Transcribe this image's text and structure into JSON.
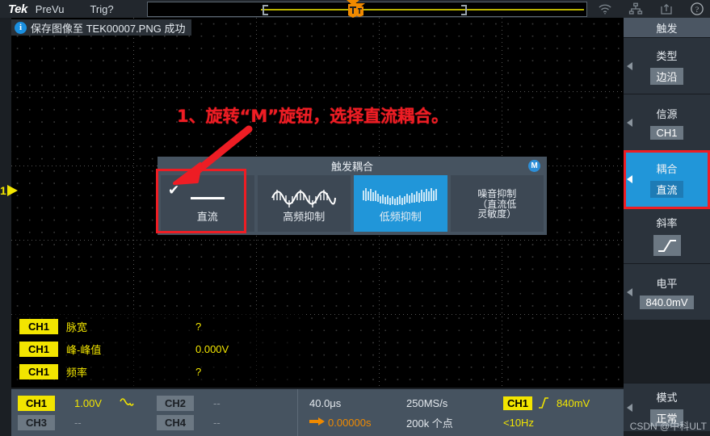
{
  "topbar": {
    "brand": "Tek",
    "prevu": "PreVu",
    "trigger_state": "Trig?",
    "icons": [
      "wifi-icon",
      "network-icon",
      "usb-eject-icon",
      "help-icon"
    ]
  },
  "message": {
    "icon": "info-icon",
    "icon_glyph": "i",
    "text": "保存图像至 TEK00007.PNG 成功"
  },
  "graticule": {
    "channel_marker_number": "1",
    "trigger_marker_letter": "T"
  },
  "annotation": {
    "text": "1、旋转“M”旋钮，选择直流耦合。",
    "color": "#ee1d24"
  },
  "dialog": {
    "title": "触发耦合",
    "badge": "M",
    "options": [
      {
        "label": "直流",
        "glyph": "dc-line-icon",
        "checked": true,
        "selected": false,
        "highlighted_red": true
      },
      {
        "label": "高频抑制",
        "glyph": "sine-wave-icon",
        "checked": false,
        "selected": false
      },
      {
        "label": "低频抑制",
        "glyph": "noisy-wave-icon",
        "checked": false,
        "selected": true
      },
      {
        "label": "噪音抑制",
        "label2": "（直流低",
        "label3": "灵敏度）",
        "glyph": "none",
        "checked": false,
        "selected": false
      }
    ]
  },
  "measurements": {
    "rows": [
      {
        "channel": "CH1",
        "name": "脉宽",
        "value": "?"
      },
      {
        "channel": "CH1",
        "name": "峰-峰值",
        "value": "0.000V"
      },
      {
        "channel": "CH1",
        "name": "频率",
        "value": "?"
      }
    ]
  },
  "sidebar": {
    "header": "触发",
    "items": [
      {
        "label": "类型",
        "value": "边沿",
        "active": false
      },
      {
        "label": "信源",
        "value": "CH1",
        "active": false
      },
      {
        "label": "耦合",
        "value": "直流",
        "active": true,
        "highlighted_red": true
      },
      {
        "label": "斜率",
        "value": "",
        "icon": "rising-edge-icon",
        "active": false
      },
      {
        "label": "电平",
        "value": "840.0mV",
        "active": false
      },
      {
        "label": "模式",
        "value": "正常",
        "active": false
      }
    ]
  },
  "statusbar": {
    "channels": [
      {
        "name": "CH1",
        "value": "1.00V",
        "icon": "ac-coupling-icon",
        "on": true
      },
      {
        "name": "CH2",
        "value": "--",
        "on": false
      },
      {
        "name": "CH3",
        "value": "--",
        "on": false
      },
      {
        "name": "CH4",
        "value": "--",
        "on": false
      }
    ],
    "timebase": "40.0μs",
    "position_icon": "trigger-position-icon",
    "position": "0.00000s",
    "sample_rate": "250MS/s",
    "record_length": "200k 个点",
    "trigger_source": "CH1",
    "trigger_slope_icon": "rising-slope-icon",
    "trigger_level": "840mV",
    "trigger_frequency": "<10Hz"
  },
  "watermark": "CSDN @中科ULT"
}
